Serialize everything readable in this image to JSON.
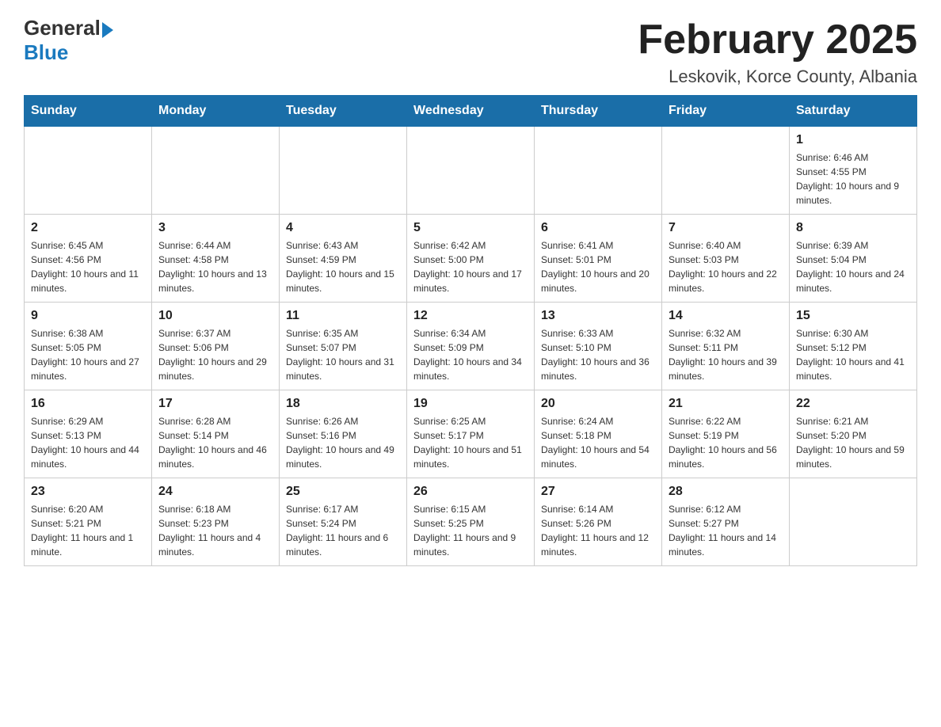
{
  "header": {
    "logo_general": "General",
    "logo_blue": "Blue",
    "title": "February 2025",
    "subtitle": "Leskovik, Korce County, Albania"
  },
  "weekdays": [
    "Sunday",
    "Monday",
    "Tuesday",
    "Wednesday",
    "Thursday",
    "Friday",
    "Saturday"
  ],
  "weeks": [
    [
      {
        "day": "",
        "info": ""
      },
      {
        "day": "",
        "info": ""
      },
      {
        "day": "",
        "info": ""
      },
      {
        "day": "",
        "info": ""
      },
      {
        "day": "",
        "info": ""
      },
      {
        "day": "",
        "info": ""
      },
      {
        "day": "1",
        "info": "Sunrise: 6:46 AM\nSunset: 4:55 PM\nDaylight: 10 hours and 9 minutes."
      }
    ],
    [
      {
        "day": "2",
        "info": "Sunrise: 6:45 AM\nSunset: 4:56 PM\nDaylight: 10 hours and 11 minutes."
      },
      {
        "day": "3",
        "info": "Sunrise: 6:44 AM\nSunset: 4:58 PM\nDaylight: 10 hours and 13 minutes."
      },
      {
        "day": "4",
        "info": "Sunrise: 6:43 AM\nSunset: 4:59 PM\nDaylight: 10 hours and 15 minutes."
      },
      {
        "day": "5",
        "info": "Sunrise: 6:42 AM\nSunset: 5:00 PM\nDaylight: 10 hours and 17 minutes."
      },
      {
        "day": "6",
        "info": "Sunrise: 6:41 AM\nSunset: 5:01 PM\nDaylight: 10 hours and 20 minutes."
      },
      {
        "day": "7",
        "info": "Sunrise: 6:40 AM\nSunset: 5:03 PM\nDaylight: 10 hours and 22 minutes."
      },
      {
        "day": "8",
        "info": "Sunrise: 6:39 AM\nSunset: 5:04 PM\nDaylight: 10 hours and 24 minutes."
      }
    ],
    [
      {
        "day": "9",
        "info": "Sunrise: 6:38 AM\nSunset: 5:05 PM\nDaylight: 10 hours and 27 minutes."
      },
      {
        "day": "10",
        "info": "Sunrise: 6:37 AM\nSunset: 5:06 PM\nDaylight: 10 hours and 29 minutes."
      },
      {
        "day": "11",
        "info": "Sunrise: 6:35 AM\nSunset: 5:07 PM\nDaylight: 10 hours and 31 minutes."
      },
      {
        "day": "12",
        "info": "Sunrise: 6:34 AM\nSunset: 5:09 PM\nDaylight: 10 hours and 34 minutes."
      },
      {
        "day": "13",
        "info": "Sunrise: 6:33 AM\nSunset: 5:10 PM\nDaylight: 10 hours and 36 minutes."
      },
      {
        "day": "14",
        "info": "Sunrise: 6:32 AM\nSunset: 5:11 PM\nDaylight: 10 hours and 39 minutes."
      },
      {
        "day": "15",
        "info": "Sunrise: 6:30 AM\nSunset: 5:12 PM\nDaylight: 10 hours and 41 minutes."
      }
    ],
    [
      {
        "day": "16",
        "info": "Sunrise: 6:29 AM\nSunset: 5:13 PM\nDaylight: 10 hours and 44 minutes."
      },
      {
        "day": "17",
        "info": "Sunrise: 6:28 AM\nSunset: 5:14 PM\nDaylight: 10 hours and 46 minutes."
      },
      {
        "day": "18",
        "info": "Sunrise: 6:26 AM\nSunset: 5:16 PM\nDaylight: 10 hours and 49 minutes."
      },
      {
        "day": "19",
        "info": "Sunrise: 6:25 AM\nSunset: 5:17 PM\nDaylight: 10 hours and 51 minutes."
      },
      {
        "day": "20",
        "info": "Sunrise: 6:24 AM\nSunset: 5:18 PM\nDaylight: 10 hours and 54 minutes."
      },
      {
        "day": "21",
        "info": "Sunrise: 6:22 AM\nSunset: 5:19 PM\nDaylight: 10 hours and 56 minutes."
      },
      {
        "day": "22",
        "info": "Sunrise: 6:21 AM\nSunset: 5:20 PM\nDaylight: 10 hours and 59 minutes."
      }
    ],
    [
      {
        "day": "23",
        "info": "Sunrise: 6:20 AM\nSunset: 5:21 PM\nDaylight: 11 hours and 1 minute."
      },
      {
        "day": "24",
        "info": "Sunrise: 6:18 AM\nSunset: 5:23 PM\nDaylight: 11 hours and 4 minutes."
      },
      {
        "day": "25",
        "info": "Sunrise: 6:17 AM\nSunset: 5:24 PM\nDaylight: 11 hours and 6 minutes."
      },
      {
        "day": "26",
        "info": "Sunrise: 6:15 AM\nSunset: 5:25 PM\nDaylight: 11 hours and 9 minutes."
      },
      {
        "day": "27",
        "info": "Sunrise: 6:14 AM\nSunset: 5:26 PM\nDaylight: 11 hours and 12 minutes."
      },
      {
        "day": "28",
        "info": "Sunrise: 6:12 AM\nSunset: 5:27 PM\nDaylight: 11 hours and 14 minutes."
      },
      {
        "day": "",
        "info": ""
      }
    ]
  ]
}
